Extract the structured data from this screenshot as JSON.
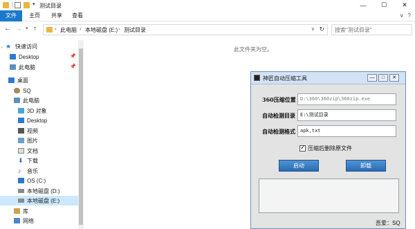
{
  "window": {
    "title": "测试目录",
    "controls": {
      "minimize": "—",
      "maximize": "☐",
      "close": "✕"
    }
  },
  "ribbon": {
    "tabs": [
      "文件",
      "主页",
      "共享",
      "查看"
    ],
    "right": {
      "collapse": "∨",
      "help": "?"
    }
  },
  "address_bar": {
    "crumbs": [
      "此电脑",
      "本地磁盘 (E:)",
      "测试目录"
    ],
    "search_placeholder": "搜索\"测试目录\""
  },
  "sidebar": {
    "items": [
      {
        "label": "快速访问",
        "icon": "star-icon"
      },
      {
        "label": "Desktop",
        "icon": "desktop-icon",
        "pinned": true
      },
      {
        "label": "此电脑",
        "icon": "computer-icon",
        "pinned": true
      },
      {
        "label": "桌面",
        "icon": "desktop-icon"
      },
      {
        "label": "SQ",
        "icon": "user-icon"
      },
      {
        "label": "此电脑",
        "icon": "computer-icon"
      },
      {
        "label": "3D 对象",
        "icon": "3d-objects-icon"
      },
      {
        "label": "Desktop",
        "icon": "desktop-icon"
      },
      {
        "label": "视频",
        "icon": "video-icon"
      },
      {
        "label": "图片",
        "icon": "pictures-icon"
      },
      {
        "label": "文档",
        "icon": "documents-icon"
      },
      {
        "label": "下载",
        "icon": "download-icon"
      },
      {
        "label": "音乐",
        "icon": "music-icon"
      },
      {
        "label": "OS (C:)",
        "icon": "windows-drive-icon"
      },
      {
        "label": "本地磁盘 (D:)",
        "icon": "drive-icon"
      },
      {
        "label": "本地磁盘 (E:)",
        "icon": "drive-icon",
        "selected": true
      },
      {
        "label": "库",
        "icon": "library-icon"
      },
      {
        "label": "网络",
        "icon": "network-icon"
      }
    ]
  },
  "main": {
    "empty_message": "此文件夹为空。"
  },
  "dialog": {
    "title": "神匠自动压缩工具",
    "controls": {
      "minimize": "—",
      "maximize": "□",
      "close": "✕"
    },
    "fields": [
      {
        "label": "360压缩位置",
        "value": "D:\\360\\360zip\\360zip.exe"
      },
      {
        "label": "自动检测目录",
        "value": "E:\\测试目录"
      },
      {
        "label": "自动检测格式",
        "value": "apk,txt"
      }
    ],
    "checkbox_label": "压缩后删除原文件",
    "checkbox_checked": true,
    "start_button": "启动",
    "unload_button": "卸载",
    "log_text": "",
    "author": "吾爱：SQ"
  }
}
